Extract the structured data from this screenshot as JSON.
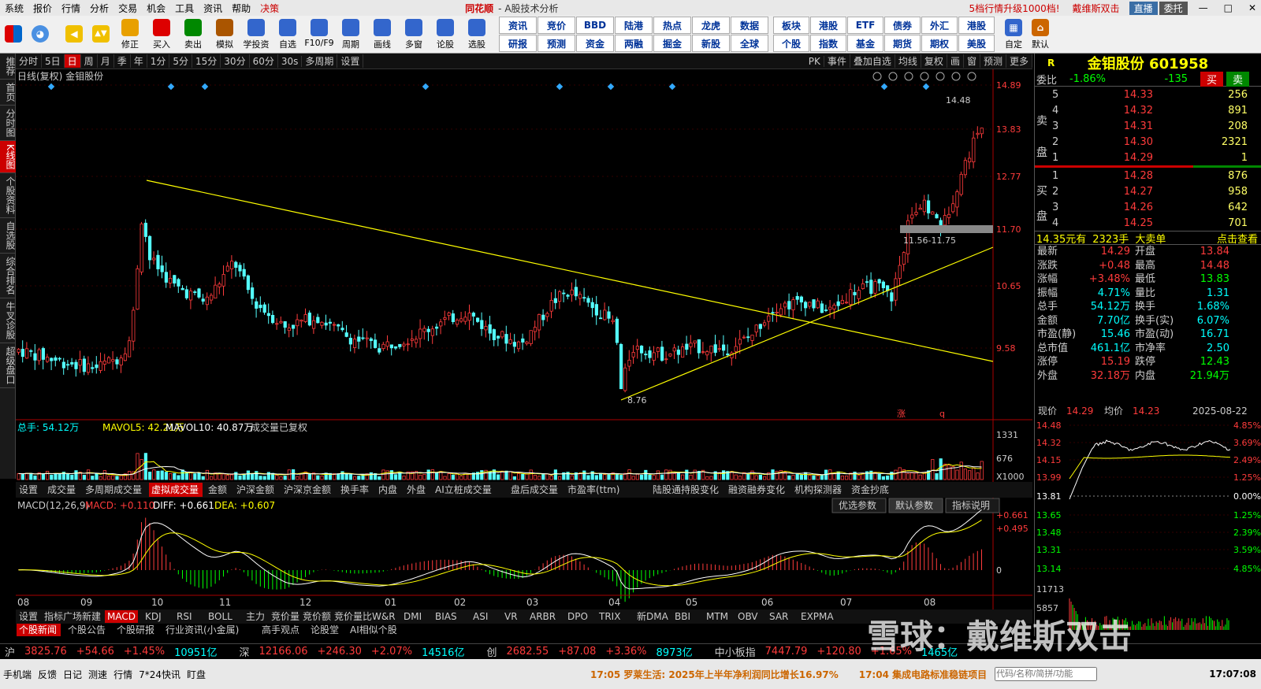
{
  "menu": [
    "系统",
    "报价",
    "行情",
    "分析",
    "交易",
    "机会",
    "工具",
    "资讯",
    "帮助",
    "决策"
  ],
  "brand": "同花顺",
  "brand_sub": "- A股技术分析",
  "promo": "5档行情升级1000档!",
  "promo2": "戴维斯双击",
  "btn_live": "直播",
  "btn_entrust": "委托",
  "toolbar": [
    {
      "label": "修正",
      "color": "#e8a000"
    },
    {
      "label": "买入",
      "color": "#d00"
    },
    {
      "label": "卖出",
      "color": "#080"
    },
    {
      "label": "模拟",
      "color": "#a50"
    },
    {
      "label": "学投资",
      "color": "#36c"
    },
    {
      "label": "自选",
      "color": "#36c"
    },
    {
      "label": "F10/F9",
      "color": "#36c"
    },
    {
      "label": "周期",
      "color": "#36c"
    },
    {
      "label": "画线",
      "color": "#36c"
    },
    {
      "label": "多窗",
      "color": "#36c"
    },
    {
      "label": "论股",
      "color": "#36c"
    },
    {
      "label": "选股",
      "color": "#36c"
    }
  ],
  "grid1": [
    "资讯",
    "竞价",
    "BBD",
    "陆港",
    "热点",
    "研报",
    "预测",
    "资金",
    "两融",
    "掘金"
  ],
  "grid_extra": [
    "龙虎",
    "数据",
    "新股",
    "全球"
  ],
  "grid2": [
    "板块",
    "港股",
    "ETF",
    "债券",
    "外汇",
    "港股",
    "个股",
    "指数",
    "基金",
    "期货",
    "期权",
    "美股"
  ],
  "grid_tail": [
    "自定",
    "默认"
  ],
  "sidebar": [
    "推荐",
    "首页",
    "分时图",
    "K线图",
    "个股资料",
    "自选股",
    "综合排名",
    "牛叉诊股",
    "超级盘口"
  ],
  "periods": [
    "分时",
    "5日",
    "日",
    "周",
    "月",
    "季",
    "年",
    "1分",
    "5分",
    "15分",
    "30分",
    "60分",
    "30s",
    "多周期",
    "设置"
  ],
  "period_right": [
    "PK",
    "事件",
    "叠加自选",
    "均线",
    "复权",
    "画",
    "窗",
    "预测",
    "更多"
  ],
  "chart_header": "日线(复权)  金钼股份",
  "price_labels": [
    "14.89",
    "13.83",
    "12.77",
    "11.70",
    "10.65",
    "9.58"
  ],
  "high_label": "14.48",
  "low_label": "8.76",
  "gap_label": "11.56-11.75",
  "vol_header": {
    "total": "总手: 54.12万",
    "mavol5": "MAVOL5: 42.21万",
    "mavol10": "MAVOL10: 40.87万",
    "note": "成交量已复权"
  },
  "vol_labels": [
    "1331",
    "676",
    "X1000"
  ],
  "ind_tabs": [
    "设置",
    "成交量",
    "多周期成交量",
    "虚拟成交量",
    "金额",
    "沪深金额",
    "沪深京金额",
    "换手率",
    "内盘",
    "外盘",
    "AI立桩成交量",
    "盘后成交量",
    "市盈率(ttm)",
    "陆股通持股变化",
    "融资融券变化",
    "机构探测器",
    "资金抄底"
  ],
  "macd_header": {
    "name": "MACD(12,26,9)",
    "macd": "MACD: +0.110",
    "diff": "DIFF: +0.661",
    "dea": "DEA: +0.607"
  },
  "macd_btns": [
    "优选参数",
    "默认参数",
    "指标说明"
  ],
  "macd_labels": [
    "+0.661",
    "+0.495",
    "0"
  ],
  "months": [
    "08",
    "09",
    "10",
    "11",
    "12",
    "01",
    "02",
    "03",
    "04",
    "05",
    "06",
    "07",
    "08"
  ],
  "ind_list": [
    "设置",
    "指标广场",
    "新建",
    "MACD",
    "KDJ",
    "RSI",
    "BOLL",
    "主力",
    "竞价量",
    "竞价额",
    "竞价量比",
    "W&R",
    "DMI",
    "BIAS",
    "ASI",
    "VR",
    "ARBR",
    "DPO",
    "TRIX",
    "新DMA",
    "BBI",
    "MTM",
    "OBV",
    "SAR",
    "EXPMA"
  ],
  "news_tabs": [
    "个股新闻",
    "个股公告",
    "个股研报",
    "行业资讯(小金属)",
    "高手观点",
    "论股堂",
    "AI相似个股"
  ],
  "quote": {
    "title": "金钼股份 601958",
    "r": "R",
    "weibi_label": "委比",
    "weibi": "-1.86%",
    "weicha": "-135",
    "buy": "买",
    "sell": "卖",
    "sell_label": "卖盘",
    "buy_label": "买盘",
    "asks": [
      {
        "lvl": "5",
        "p": "14.33",
        "v": "256"
      },
      {
        "lvl": "4",
        "p": "14.32",
        "v": "891"
      },
      {
        "lvl": "3",
        "p": "14.31",
        "v": "208"
      },
      {
        "lvl": "2",
        "p": "14.30",
        "v": "2321"
      },
      {
        "lvl": "1",
        "p": "14.29",
        "v": "1"
      }
    ],
    "bids": [
      {
        "lvl": "1",
        "p": "14.28",
        "v": "876"
      },
      {
        "lvl": "2",
        "p": "14.27",
        "v": "958"
      },
      {
        "lvl": "3",
        "p": "14.26",
        "v": "642"
      },
      {
        "lvl": "4",
        "p": "14.25",
        "v": "701"
      }
    ],
    "big_order": {
      "p": "14.35元有",
      "v": "2323手",
      "t": "大卖单",
      "link": "点击查看"
    },
    "stats": [
      [
        "最新",
        "14.29",
        "开盘",
        "13.84"
      ],
      [
        "涨跌",
        "+0.48",
        "最高",
        "14.48"
      ],
      [
        "涨幅",
        "+3.48%",
        "最低",
        "13.83"
      ],
      [
        "振幅",
        "4.71%",
        "量比",
        "1.31"
      ],
      [
        "总手",
        "54.12万",
        "换手",
        "1.68%"
      ],
      [
        "金额",
        "7.70亿",
        "换手(实)",
        "6.07%"
      ],
      [
        "市盈(静)",
        "15.46",
        "市盈(动)",
        "16.71"
      ],
      [
        "总市值",
        "461.1亿",
        "市净率",
        "2.50"
      ],
      [
        "涨停",
        "15.19",
        "跌停",
        "12.43"
      ],
      [
        "外盘",
        "32.18万",
        "内盘",
        "21.94万"
      ]
    ],
    "intraday": {
      "now_label": "现价",
      "now": "14.29",
      "avg_label": "均价",
      "avg": "14.23",
      "date": "2025-08-22",
      "left": [
        "14.48",
        "14.32",
        "14.15",
        "13.99",
        "13.81",
        "13.65",
        "13.48",
        "13.31",
        "13.14",
        "11713",
        "5857"
      ],
      "right": [
        "4.85%",
        "3.69%",
        "2.49%",
        "1.25%",
        "0.00%",
        "1.25%",
        "2.39%",
        "3.59%",
        "4.85%"
      ]
    }
  },
  "status": [
    {
      "t": "沪",
      "c": "#ccc"
    },
    {
      "t": "3825.76",
      "c": "#ff3b3b"
    },
    {
      "t": "+54.66",
      "c": "#ff3b3b"
    },
    {
      "t": "+1.45%",
      "c": "#ff3b3b"
    },
    {
      "t": "10951亿",
      "c": "#0ff"
    },
    {
      "t": "深",
      "c": "#ccc"
    },
    {
      "t": "12166.06",
      "c": "#ff3b3b"
    },
    {
      "t": "+246.30",
      "c": "#ff3b3b"
    },
    {
      "t": "+2.07%",
      "c": "#ff3b3b"
    },
    {
      "t": "14516亿",
      "c": "#0ff"
    },
    {
      "t": "创",
      "c": "#ccc"
    },
    {
      "t": "2682.55",
      "c": "#ff3b3b"
    },
    {
      "t": "+87.08",
      "c": "#ff3b3b"
    },
    {
      "t": "+3.36%",
      "c": "#ff3b3b"
    },
    {
      "t": "8973亿",
      "c": "#0ff"
    },
    {
      "t": "中小板指",
      "c": "#ccc"
    },
    {
      "t": "7447.79",
      "c": "#ff3b3b"
    },
    {
      "t": "+120.80",
      "c": "#ff3b3b"
    },
    {
      "t": "+1.65%",
      "c": "#ff3b3b"
    },
    {
      "t": "1465亿",
      "c": "#0ff"
    }
  ],
  "bottom": [
    "手机端",
    "反馈",
    "日记",
    "测速",
    "行情",
    "7*24快讯",
    "盯盘"
  ],
  "news1": "17:05 罗莱生活: 2025年上半年净利润同比增长16.97%",
  "news2": "17:04 集成电路标准稳链项目",
  "search_placeholder": "代码/名称/简拼/功能",
  "clock": "17:07:08",
  "watermark": "雪球：戴维斯双击",
  "kline_marks": [
    "涨",
    "q"
  ]
}
